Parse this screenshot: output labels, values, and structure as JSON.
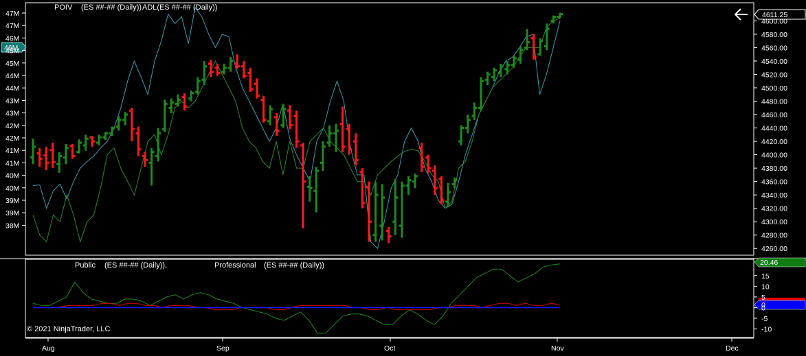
{
  "chart_data": [
    {
      "type": "line",
      "panel": "price",
      "title": "POIV",
      "series_labels": [
        "(ES ##-## (Daily))",
        "ADL(ES ##-## (Daily))"
      ],
      "right_axis": {
        "ticks": [
          "4600.00",
          "4580.00",
          "4560.00",
          "4540.00",
          "4520.00",
          "4500.00",
          "4480.00",
          "4460.00",
          "4440.00",
          "4420.00",
          "4400.00",
          "4380.00",
          "4360.00",
          "4340.00",
          "4320.00",
          "4300.00",
          "4280.00",
          "4260.00"
        ],
        "range": [
          4250,
          4625
        ],
        "current_value": "4611.25"
      },
      "left_axis": {
        "ticks": [
          "47M",
          "47M",
          "46M",
          "45M",
          "45M",
          "44M",
          "44M",
          "43M",
          "43M",
          "42M",
          "42M",
          "41M",
          "41M",
          "40M",
          "40M",
          "39M",
          "39M",
          "38M"
        ],
        "marker": "46M"
      },
      "bars": [
        {
          "high": 4424,
          "low": 4386,
          "open": 4396,
          "close": 4412,
          "color": "green"
        },
        {
          "high": 4410,
          "low": 4382,
          "open": 4402,
          "close": 4394,
          "color": "red"
        },
        {
          "high": 4412,
          "low": 4377,
          "open": 4399,
          "close": 4388,
          "color": "red"
        },
        {
          "high": 4418,
          "low": 4380,
          "open": 4407,
          "close": 4389,
          "color": "red"
        },
        {
          "high": 4404,
          "low": 4373,
          "open": 4386,
          "close": 4398,
          "color": "green"
        },
        {
          "high": 4416,
          "low": 4386,
          "open": 4396,
          "close": 4410,
          "color": "green"
        },
        {
          "high": 4416,
          "low": 4394,
          "open": 4413,
          "close": 4398,
          "color": "red"
        },
        {
          "high": 4423,
          "low": 4402,
          "open": 4404,
          "close": 4418,
          "color": "green"
        },
        {
          "high": 4430,
          "low": 4406,
          "open": 4414,
          "close": 4424,
          "color": "green"
        },
        {
          "high": 4428,
          "low": 4412,
          "open": 4426,
          "close": 4420,
          "color": "red"
        },
        {
          "high": 4430,
          "low": 4414,
          "open": 4418,
          "close": 4426,
          "color": "green"
        },
        {
          "high": 4434,
          "low": 4422,
          "open": 4426,
          "close": 4432,
          "color": "green"
        },
        {
          "high": 4442,
          "low": 4428,
          "open": 4432,
          "close": 4440,
          "color": "green"
        },
        {
          "high": 4458,
          "low": 4436,
          "open": 4442,
          "close": 4452,
          "color": "green"
        },
        {
          "high": 4464,
          "low": 4444,
          "open": 4452,
          "close": 4460,
          "color": "green"
        },
        {
          "high": 4470,
          "low": 4420,
          "open": 4466,
          "close": 4438,
          "color": "red"
        },
        {
          "high": 4442,
          "low": 4398,
          "open": 4432,
          "close": 4408,
          "color": "red"
        },
        {
          "high": 4404,
          "low": 4382,
          "open": 4398,
          "close": 4392,
          "color": "red"
        },
        {
          "high": 4410,
          "low": 4354,
          "open": 4388,
          "close": 4404,
          "color": "green"
        },
        {
          "high": 4440,
          "low": 4390,
          "open": 4398,
          "close": 4432,
          "color": "green"
        },
        {
          "high": 4482,
          "low": 4434,
          "open": 4438,
          "close": 4476,
          "color": "green"
        },
        {
          "high": 4484,
          "low": 4462,
          "open": 4470,
          "close": 4478,
          "color": "green"
        },
        {
          "high": 4490,
          "low": 4472,
          "open": 4476,
          "close": 4482,
          "color": "green"
        },
        {
          "high": 4492,
          "low": 4466,
          "open": 4486,
          "close": 4472,
          "color": "red"
        },
        {
          "high": 4496,
          "low": 4480,
          "open": 4484,
          "close": 4492,
          "color": "green"
        },
        {
          "high": 4516,
          "low": 4490,
          "open": 4494,
          "close": 4510,
          "color": "green"
        },
        {
          "high": 4540,
          "low": 4504,
          "open": 4512,
          "close": 4532,
          "color": "green"
        },
        {
          "high": 4542,
          "low": 4516,
          "open": 4536,
          "close": 4524,
          "color": "red"
        },
        {
          "high": 4536,
          "low": 4518,
          "open": 4530,
          "close": 4522,
          "color": "red"
        },
        {
          "high": 4536,
          "low": 4520,
          "open": 4524,
          "close": 4530,
          "color": "green"
        },
        {
          "high": 4546,
          "low": 4524,
          "open": 4530,
          "close": 4540,
          "color": "green"
        },
        {
          "high": 4550,
          "low": 4528,
          "open": 4536,
          "close": 4532,
          "color": "red"
        },
        {
          "high": 4540,
          "low": 4514,
          "open": 4532,
          "close": 4518,
          "color": "red"
        },
        {
          "high": 4530,
          "low": 4494,
          "open": 4522,
          "close": 4498,
          "color": "red"
        },
        {
          "high": 4514,
          "low": 4484,
          "open": 4506,
          "close": 4488,
          "color": "red"
        },
        {
          "high": 4488,
          "low": 4448,
          "open": 4482,
          "close": 4452,
          "color": "red"
        },
        {
          "high": 4474,
          "low": 4444,
          "open": 4450,
          "close": 4468,
          "color": "green"
        },
        {
          "high": 4462,
          "low": 4428,
          "open": 4456,
          "close": 4436,
          "color": "red"
        },
        {
          "high": 4476,
          "low": 4440,
          "open": 4444,
          "close": 4468,
          "color": "green"
        },
        {
          "high": 4474,
          "low": 4438,
          "open": 4466,
          "close": 4444,
          "color": "red"
        },
        {
          "high": 4466,
          "low": 4410,
          "open": 4458,
          "close": 4420,
          "color": "red"
        },
        {
          "high": 4418,
          "low": 4290,
          "open": 4414,
          "close": 4360,
          "color": "red"
        },
        {
          "high": 4368,
          "low": 4330,
          "open": 4352,
          "close": 4350,
          "color": "green"
        },
        {
          "high": 4382,
          "low": 4314,
          "open": 4346,
          "close": 4376,
          "color": "green"
        },
        {
          "high": 4420,
          "low": 4376,
          "open": 4388,
          "close": 4412,
          "color": "green"
        },
        {
          "high": 4444,
          "low": 4412,
          "open": 4418,
          "close": 4432,
          "color": "green"
        },
        {
          "high": 4446,
          "low": 4404,
          "open": 4432,
          "close": 4436,
          "color": "green"
        },
        {
          "high": 4472,
          "low": 4404,
          "open": 4446,
          "close": 4412,
          "color": "red"
        },
        {
          "high": 4446,
          "low": 4400,
          "open": 4438,
          "close": 4408,
          "color": "red"
        },
        {
          "high": 4432,
          "low": 4384,
          "open": 4420,
          "close": 4392,
          "color": "red"
        },
        {
          "high": 4380,
          "low": 4320,
          "open": 4374,
          "close": 4328,
          "color": "red"
        },
        {
          "high": 4360,
          "low": 4270,
          "open": 4352,
          "close": 4300,
          "color": "red"
        },
        {
          "high": 4360,
          "low": 4270,
          "open": 4280,
          "close": 4340,
          "color": "green"
        },
        {
          "high": 4356,
          "low": 4272,
          "open": 4294,
          "close": 4336,
          "color": "green"
        },
        {
          "high": 4292,
          "low": 4268,
          "open": 4286,
          "close": 4278,
          "color": "red"
        },
        {
          "high": 4364,
          "low": 4280,
          "open": 4300,
          "close": 4336,
          "color": "green"
        },
        {
          "high": 4360,
          "low": 4276,
          "open": 4294,
          "close": 4354,
          "color": "green"
        },
        {
          "high": 4368,
          "low": 4340,
          "open": 4354,
          "close": 4362,
          "color": "green"
        },
        {
          "high": 4372,
          "low": 4350,
          "open": 4360,
          "close": 4368,
          "color": "green"
        },
        {
          "high": 4418,
          "low": 4374,
          "open": 4410,
          "close": 4382,
          "color": "red"
        },
        {
          "high": 4400,
          "low": 4372,
          "open": 4396,
          "close": 4380,
          "color": "red"
        },
        {
          "high": 4384,
          "low": 4340,
          "open": 4376,
          "close": 4350,
          "color": "red"
        },
        {
          "high": 4368,
          "low": 4326,
          "open": 4364,
          "close": 4332,
          "color": "red"
        },
        {
          "high": 4358,
          "low": 4322,
          "open": 4330,
          "close": 4344,
          "color": "green"
        },
        {
          "high": 4366,
          "low": 4350,
          "open": 4356,
          "close": 4362,
          "color": "green"
        },
        {
          "high": 4444,
          "low": 4414,
          "open": 4420,
          "close": 4440,
          "color": "green"
        },
        {
          "high": 4460,
          "low": 4432,
          "open": 4440,
          "close": 4452,
          "color": "green"
        },
        {
          "high": 4478,
          "low": 4452,
          "open": 4458,
          "close": 4470,
          "color": "green"
        },
        {
          "high": 4516,
          "low": 4466,
          "open": 4470,
          "close": 4510,
          "color": "green"
        },
        {
          "high": 4524,
          "low": 4504,
          "open": 4512,
          "close": 4520,
          "color": "green"
        },
        {
          "high": 4530,
          "low": 4510,
          "open": 4516,
          "close": 4526,
          "color": "green"
        },
        {
          "high": 4536,
          "low": 4516,
          "open": 4522,
          "close": 4532,
          "color": "green"
        },
        {
          "high": 4540,
          "low": 4520,
          "open": 4528,
          "close": 4534,
          "color": "green"
        },
        {
          "high": 4548,
          "low": 4530,
          "open": 4534,
          "close": 4544,
          "color": "green"
        },
        {
          "high": 4562,
          "low": 4536,
          "open": 4542,
          "close": 4556,
          "color": "green"
        },
        {
          "high": 4588,
          "low": 4556,
          "open": 4560,
          "close": 4568,
          "color": "green"
        },
        {
          "high": 4580,
          "low": 4542,
          "open": 4574,
          "close": 4546,
          "color": "red"
        },
        {
          "high": 4574,
          "low": 4548,
          "open": 4550,
          "close": 4570,
          "color": "green"
        },
        {
          "high": 4596,
          "low": 4556,
          "open": 4562,
          "close": 4588,
          "color": "green"
        },
        {
          "high": 4608,
          "low": 4596,
          "open": 4600,
          "close": 4606,
          "color": "green"
        },
        {
          "high": 4612,
          "low": 4604,
          "open": 4606,
          "close": 4610,
          "color": "green"
        }
      ],
      "line_blue": [
        4354,
        4355,
        4320,
        4346,
        4356,
        4334,
        4360,
        4380,
        4390,
        4398,
        4410,
        4420,
        4440,
        4470,
        4510,
        4540,
        4516,
        4490,
        4540,
        4570,
        4610,
        4596,
        4606,
        4566,
        4620,
        4606,
        4580,
        4560,
        4580,
        4576,
        4530,
        4500,
        4480,
        4460,
        4440,
        4420,
        4440,
        4476,
        4424,
        4400,
        4380,
        4360,
        4420,
        4440,
        4480,
        4510,
        4480,
        4410,
        4370,
        4370,
        4270,
        4260,
        4300,
        4350,
        4370,
        4420,
        4440,
        4420,
        4380,
        4360,
        4332,
        4320,
        4326,
        4360,
        4400,
        4430,
        4460,
        4480,
        4500,
        4524,
        4540,
        4546,
        4560,
        4576,
        4580,
        4490,
        4520,
        4560,
        4600
      ],
      "line_green": [
        4310,
        4280,
        4270,
        4310,
        4300,
        4340,
        4310,
        4270,
        4300,
        4310,
        4350,
        4400,
        4410,
        4380,
        4360,
        4340,
        4380,
        4420,
        4430,
        4400,
        4430,
        4470,
        4480,
        4470,
        4480,
        4500,
        4520,
        4540,
        4520,
        4500,
        4480,
        4440,
        4420,
        4410,
        4390,
        4380,
        4420,
        4370,
        4420,
        4380,
        4380,
        4420,
        4430,
        4440,
        4420,
        4410,
        4400,
        4380,
        4360,
        4360,
        4340,
        4370,
        4380,
        4390,
        4398,
        4405,
        4408,
        4406,
        4390,
        4370,
        4360,
        4320,
        4330,
        4380,
        4390,
        4420,
        4460,
        4480,
        4500,
        4510,
        4520,
        4530,
        4546,
        4560,
        4560,
        4560,
        4590,
        4600,
        4604
      ]
    },
    {
      "type": "line",
      "panel": "indicator",
      "title": "Public",
      "series_labels": [
        "(ES ##-## (Daily)),",
        "Professional",
        "(ES ##-## (Daily))"
      ],
      "right_axis": {
        "ticks": [
          "15",
          "10",
          "5",
          "0",
          "-5",
          "-10"
        ],
        "range": [
          -14,
          22
        ],
        "green_value": "20.46",
        "blue_value": "0"
      },
      "green": [
        2,
        1,
        1,
        3,
        5,
        12,
        7,
        4,
        3,
        2,
        2,
        4,
        4,
        3,
        1,
        3,
        5,
        6,
        4,
        6,
        7,
        6,
        4,
        3,
        2,
        0,
        -1,
        -2,
        -3,
        -5,
        -6,
        -4,
        -2,
        -6,
        -12,
        -12,
        -8,
        -4,
        -3,
        -3,
        -4,
        -6,
        -8,
        -8,
        -4,
        -1,
        -3,
        -6,
        -8,
        -4,
        2,
        6,
        10,
        14,
        16,
        18,
        18,
        15,
        12,
        14,
        16,
        19,
        20,
        20.46
      ],
      "red": [
        0,
        0,
        0,
        0,
        1,
        1,
        1,
        1,
        2,
        2,
        1,
        2,
        2,
        1,
        1,
        0,
        1,
        1,
        1,
        0,
        0,
        -1,
        -1,
        -1,
        0,
        0,
        0,
        0,
        -1,
        -1,
        0,
        1,
        1,
        1,
        1,
        1,
        1,
        0,
        0,
        -1,
        -1,
        0,
        -1,
        -1,
        -1,
        -1,
        -1,
        0,
        0,
        1,
        1,
        1,
        0,
        1,
        2,
        2,
        1,
        2,
        1,
        1,
        2,
        1
      ],
      "blue": 0
    }
  ],
  "x_axis": {
    "labels": [
      "Aug",
      "Sep",
      "Oct",
      "Nov",
      "Dec"
    ]
  },
  "footer": {
    "copyright": "© 2021 NinjaTrader, LLC"
  }
}
